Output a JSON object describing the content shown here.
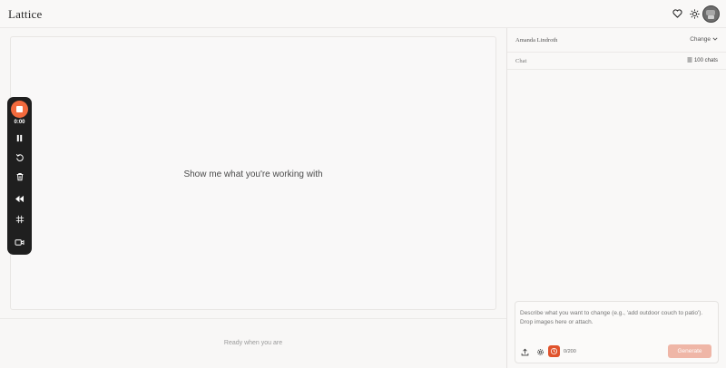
{
  "app": {
    "title": "Lattice"
  },
  "header": {
    "icons": [
      "heart-icon",
      "sun-icon"
    ],
    "avatar": "user-avatar"
  },
  "canvas": {
    "message": "Show me what you're working with",
    "status": "Ready when you are"
  },
  "recorder": {
    "time": "0:00",
    "tools": [
      "stop-icon",
      "pause-icon",
      "restart-icon",
      "trash-icon",
      "rewind-icon",
      "grid-icon",
      "camera-icon"
    ],
    "accent": "#f26a3d"
  },
  "sidebar": {
    "user_name": "Amanda Lindroth",
    "change_label": "Change",
    "chat_label": "Chat",
    "chat_count": "100 chats"
  },
  "composer": {
    "placeholder": "Describe what you want to change (e.g., 'add outdoor couch to patio'). Drop images here or attach.",
    "counter": "0/200",
    "generate_label": "Generate",
    "accent": "#e0532c"
  }
}
